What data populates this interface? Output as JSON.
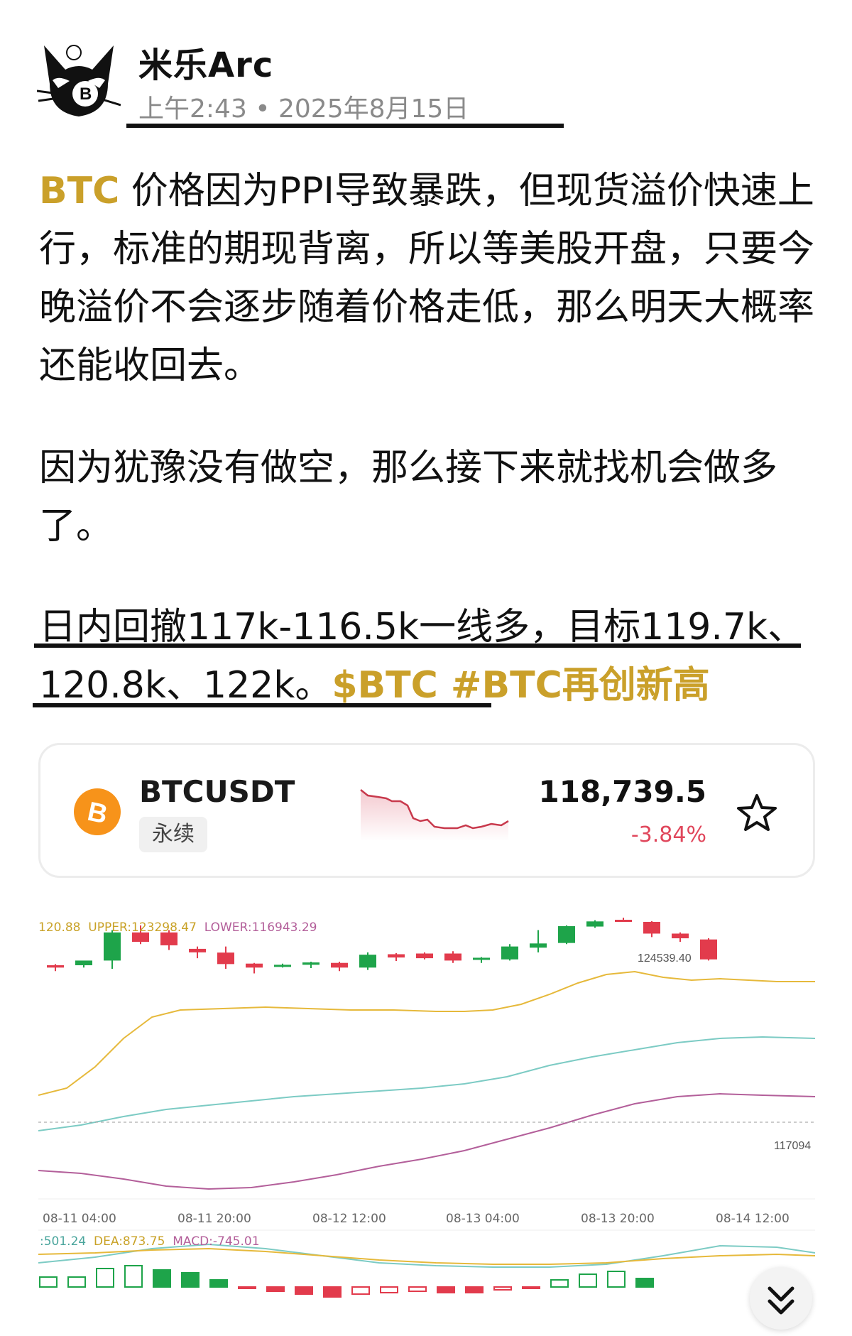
{
  "post": {
    "author": "米乐Arc",
    "time": "上午2:43",
    "date": "2025年8月15日",
    "paragraph1_tag": "BTC",
    "paragraph1_body": " 价格因为PPI导致暴跌，但现货溢价快速上行，标准的期现背离，所以等美股开盘，只要今晚溢价不会逐步随着价格走低，那么明天大概率还能收回去。",
    "paragraph2": "因为犹豫没有做空，那么接下来就找机会做多了。",
    "paragraph3_text": "日内回撤117k-116.5k一线多，目标119.7k、120.8k、122k。",
    "paragraph3_tags": "$BTC #BTC再创新高"
  },
  "ticker": {
    "symbol": "BTCUSDT",
    "badge": "永续",
    "price": "118,739.5",
    "change": "-3.84%",
    "change_color": "#e0465b",
    "logo_color": "#f7931a",
    "star_icon": "star-outline"
  },
  "chart": {
    "boll_legend_mid": "120.88",
    "boll_legend_upper": "UPPER:123298.47",
    "boll_legend_lower": "LOWER:116943.29",
    "high_label": "124539.40",
    "right_label": "117094",
    "macd_dif": ":501.24",
    "macd_dea": "DEA:873.75",
    "macd_val": "MACD:-745.01",
    "x_labels": [
      "08-11 04:00",
      "08-11 20:00",
      "08-12 12:00",
      "08-13 04:00",
      "08-13 20:00",
      "08-14 12:00"
    ],
    "up_color": "#1ea44a",
    "down_color": "#e23b4c"
  },
  "chart_data": {
    "type": "candlestick",
    "series": [
      {
        "o": 0.9,
        "c": 0.91,
        "h": 0.925,
        "l": 0.895
      },
      {
        "o": 0.9,
        "c": 0.88,
        "h": 0.91,
        "l": 0.89
      },
      {
        "o": 0.88,
        "c": 0.76,
        "h": 0.75,
        "l": 0.915
      },
      {
        "o": 0.76,
        "c": 0.8,
        "h": 0.73,
        "l": 0.81
      },
      {
        "o": 0.76,
        "c": 0.815,
        "h": 0.75,
        "l": 0.835
      },
      {
        "o": 0.83,
        "c": 0.845,
        "h": 0.82,
        "l": 0.87
      },
      {
        "o": 0.846,
        "c": 0.895,
        "h": 0.82,
        "l": 0.915
      },
      {
        "o": 0.893,
        "c": 0.91,
        "h": 0.89,
        "l": 0.935
      },
      {
        "o": 0.905,
        "c": 0.898,
        "h": 0.893,
        "l": 0.91
      },
      {
        "o": 0.898,
        "c": 0.888,
        "h": 0.885,
        "l": 0.912
      },
      {
        "o": 0.89,
        "c": 0.91,
        "h": 0.885,
        "l": 0.925
      },
      {
        "o": 0.91,
        "c": 0.855,
        "h": 0.845,
        "l": 0.92
      },
      {
        "o": 0.853,
        "c": 0.867,
        "h": 0.848,
        "l": 0.882
      },
      {
        "o": 0.85,
        "c": 0.87,
        "h": 0.845,
        "l": 0.875
      },
      {
        "o": 0.85,
        "c": 0.88,
        "h": 0.84,
        "l": 0.89
      },
      {
        "o": 0.875,
        "c": 0.868,
        "h": 0.865,
        "l": 0.89
      },
      {
        "o": 0.875,
        "c": 0.82,
        "h": 0.81,
        "l": 0.88
      },
      {
        "o": 0.825,
        "c": 0.807,
        "h": 0.75,
        "l": 0.845
      },
      {
        "o": 0.805,
        "c": 0.733,
        "h": 0.73,
        "l": 0.81
      },
      {
        "o": 0.735,
        "c": 0.713,
        "h": 0.708,
        "l": 0.74
      },
      {
        "o": 0.706,
        "c": 0.708,
        "h": 0.668,
        "l": 0.71
      },
      {
        "o": 0.715,
        "c": 0.765,
        "h": 0.712,
        "l": 0.78
      },
      {
        "o": 0.765,
        "c": 0.785,
        "h": 0.76,
        "l": 0.8
      },
      {
        "o": 0.79,
        "c": 0.875,
        "h": 0.785,
        "l": 0.88
      }
    ]
  }
}
